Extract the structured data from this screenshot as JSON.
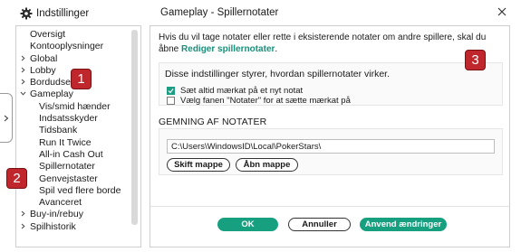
{
  "left_header": {
    "title": "Indstillinger",
    "icon": "gear-icon"
  },
  "right_header": {
    "title": "Gameplay - Spillernotater",
    "close_icon": "close-icon"
  },
  "nav": {
    "items": [
      {
        "label": "Oversigt",
        "level": 0,
        "chevron": ""
      },
      {
        "label": "Kontooplysninger",
        "level": 0,
        "chevron": ""
      },
      {
        "label": "Global",
        "level": 0,
        "chevron": ">"
      },
      {
        "label": "Lobby",
        "level": 0,
        "chevron": ">"
      },
      {
        "label": "Bordudseende",
        "level": 0,
        "chevron": ">"
      },
      {
        "label": "Gameplay",
        "level": 0,
        "chevron": "v"
      },
      {
        "label": "Vis/smid hænder",
        "level": 1,
        "chevron": ""
      },
      {
        "label": "Indsatsskyder",
        "level": 1,
        "chevron": ""
      },
      {
        "label": "Tidsbank",
        "level": 1,
        "chevron": ""
      },
      {
        "label": "Run It Twice",
        "level": 1,
        "chevron": ""
      },
      {
        "label": "All-in Cash Out",
        "level": 1,
        "chevron": ""
      },
      {
        "label": "Spillernotater",
        "level": 1,
        "chevron": ""
      },
      {
        "label": "Genvejstaster",
        "level": 1,
        "chevron": ""
      },
      {
        "label": "Spil ved flere borde",
        "level": 1,
        "chevron": ""
      },
      {
        "label": "Avanceret",
        "level": 1,
        "chevron": ""
      },
      {
        "label": "Buy-in/rebuy",
        "level": 0,
        "chevron": ">"
      },
      {
        "label": "Spilhistorik",
        "level": 0,
        "chevron": ">"
      }
    ],
    "active_index": 11
  },
  "panel": {
    "intro_text": "Hvis du vil tage notater eller rette i eksisterende notater om andre spillere, skal du åbne ",
    "intro_link": "Rediger spillernotater",
    "intro_end": ".",
    "settings_heading": "Disse indstillinger styrer, hvordan spillernotater virker.",
    "checkbox1": {
      "label": "Sæt altid mærkat på et nyt notat",
      "checked": true
    },
    "checkbox2": {
      "label": "Vælg fanen \"Notater\" for at sætte mærkat på",
      "checked": false
    },
    "save_heading": "GEMNING AF NOTATER",
    "path_value": "C:\\Users\\WindowsID\\Local\\PokerStars\\",
    "change_folder_label": "Skift mappe",
    "open_folder_label": "Åbn mappe"
  },
  "footer": {
    "ok_label": "OK",
    "cancel_label": "Annuller",
    "apply_label": "Anvend ændringer"
  },
  "badges": [
    "1",
    "2",
    "3"
  ],
  "colors": {
    "accent": "#17a07f",
    "link": "#1b8f7a",
    "badge": "#c0272d"
  }
}
